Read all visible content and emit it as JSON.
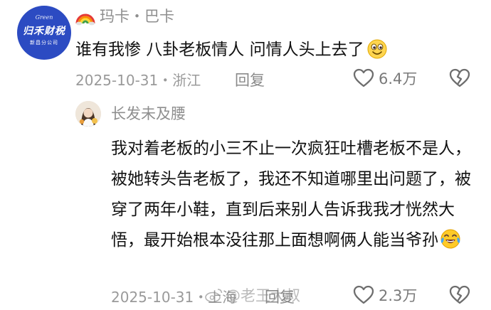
{
  "comment": {
    "avatar": {
      "brand_en": "Green",
      "brand_cn": "归禾财税",
      "brand_sub": "新昌分公司"
    },
    "username": "玛卡・巴卡",
    "text": "谁有我惨 八卦老板情人 问情人头上去了",
    "date": "2025-10-31",
    "location": "浙江",
    "reply_label": "回复",
    "like_count": "6.4万",
    "colors": {
      "avatar_bg": "#2c4bc2",
      "meta_gray": "#9a9a9a"
    }
  },
  "reply": {
    "username": "长发未及腰",
    "text": "我对着老板的小三不止一次疯狂吐槽老板不是人，被她转头告老板了，我还不知道哪里出问题了，被穿了两年小鞋，直到后来别人告诉我我才恍然大悟，最开始根本没往那上面想啊俩人能当爷孙",
    "date": "2025-10-31",
    "location": "上海",
    "reply_label": "回复",
    "like_count": "2.3万"
  },
  "watermark": {
    "text": "@老王大叔"
  },
  "icons": [
    "rainbow-icon",
    "smile-emoji-icon",
    "laugh-cry-emoji-icon",
    "heart-outline-icon",
    "broken-heart-icon",
    "weibo-icon"
  ]
}
